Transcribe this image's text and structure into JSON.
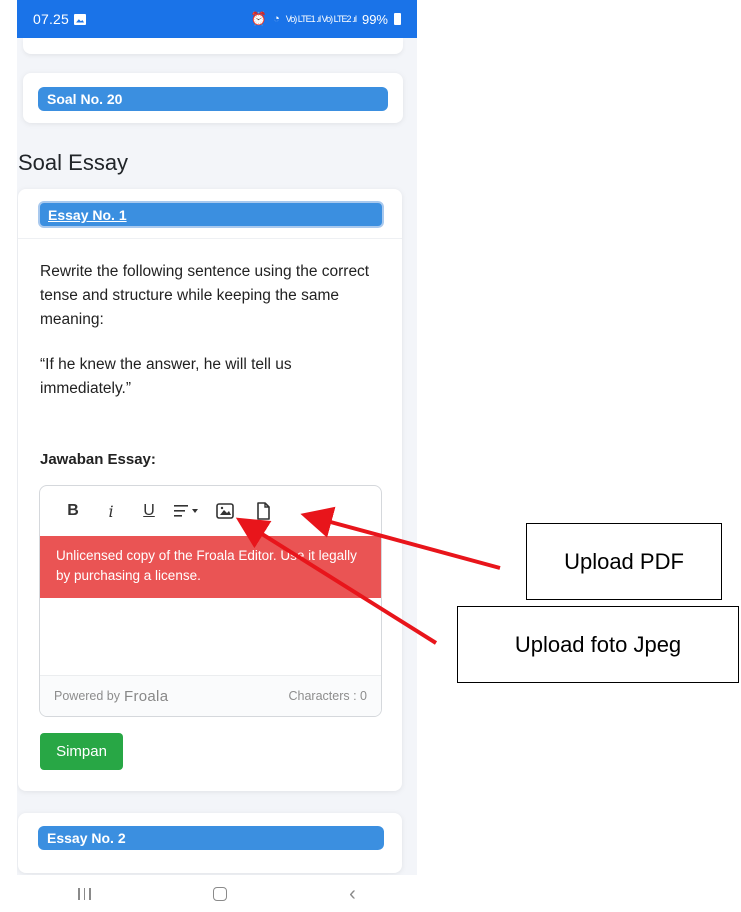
{
  "status_bar": {
    "time": "07.25",
    "battery": "99%",
    "signal": "Vo) LTE1 .ıl Vo) LTE2 .ıl"
  },
  "objective_card": {
    "label": "Soal No. 20"
  },
  "section": {
    "title": "Soal Essay"
  },
  "essay1": {
    "label": "Essay No. 1",
    "question": "Rewrite the following sentence using the correct tense and structure while keeping the same meaning:",
    "quote": "“If he knew the answer, he will tell us immediately.”",
    "answer_label": "Jawaban Essay:",
    "editor": {
      "toolbar": {
        "bold": "B",
        "italic": "i",
        "underline": "U",
        "align": "≡▾"
      },
      "license_notice": "Unlicensed copy of the Froala Editor. Use it legally by purchasing a license.",
      "powered_by": "Powered by",
      "brand": "Froala",
      "characters": "Characters : 0"
    },
    "save_button": "Simpan"
  },
  "essay2": {
    "label": "Essay No. 2"
  },
  "annotations": {
    "upload_pdf": "Upload PDF",
    "upload_jpeg": "Upload foto Jpeg",
    "arrow_color": "#e8151b"
  }
}
